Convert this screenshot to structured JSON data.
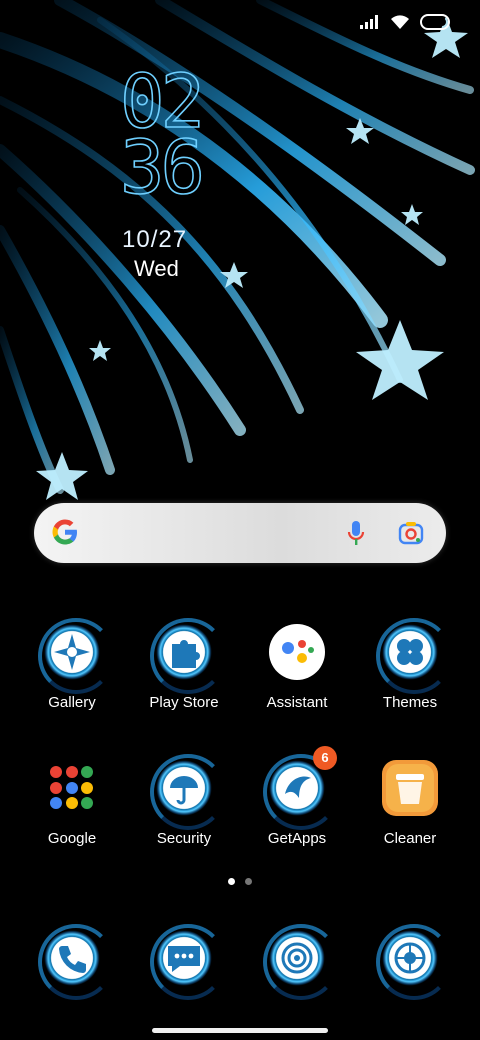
{
  "status_bar": {
    "signal_icon": "signal-icon",
    "wifi_icon": "wifi-icon",
    "battery_icon": "battery-icon"
  },
  "clock": {
    "hours": "02",
    "minutes": "36",
    "date": "10/27",
    "day": "Wed"
  },
  "search": {
    "google_icon": "google-g-icon",
    "mic_icon": "mic-icon",
    "lens_icon": "lens-icon"
  },
  "apps_row1": [
    {
      "label": "Gallery",
      "icon": "compass-icon"
    },
    {
      "label": "Play Store",
      "icon": "puzzle-icon"
    },
    {
      "label": "Assistant",
      "icon": "assistant-icon"
    },
    {
      "label": "Themes",
      "icon": "clover-icon"
    }
  ],
  "apps_row2": [
    {
      "label": "Google",
      "icon": "google-folder-icon"
    },
    {
      "label": "Security",
      "icon": "umbrella-icon"
    },
    {
      "label": "GetApps",
      "icon": "getapps-icon",
      "badge": "6"
    },
    {
      "label": "Cleaner",
      "icon": "trash-icon"
    }
  ],
  "dock": [
    {
      "icon": "phone-icon"
    },
    {
      "icon": "messages-icon"
    },
    {
      "icon": "browser-icon"
    },
    {
      "icon": "camera-icon"
    }
  ],
  "page_indicator": {
    "pages": 2,
    "active": 1
  },
  "colors": {
    "accent": "#52c8ff",
    "badge": "#ef5a24",
    "background": "#000000"
  }
}
